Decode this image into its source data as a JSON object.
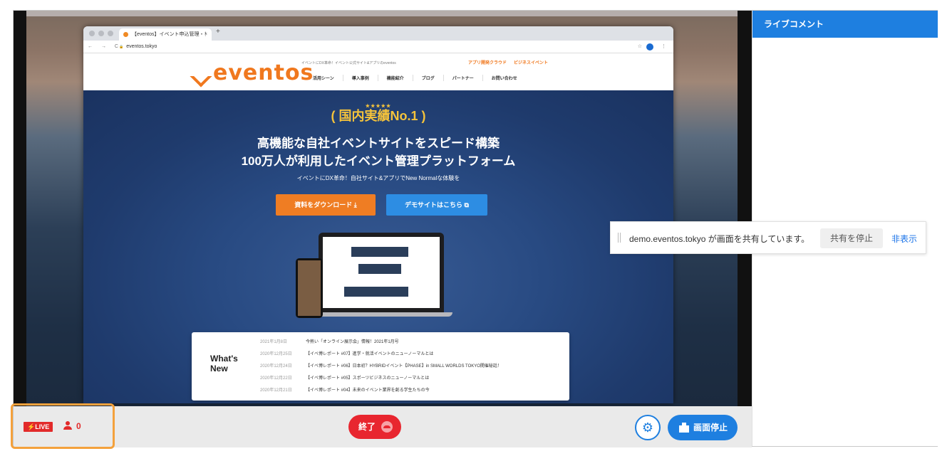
{
  "stream": {
    "browser": {
      "tab_title": "【eventos】イベント申込管理・！",
      "url": "eventos.tokyo"
    },
    "site": {
      "logo": "eventos",
      "tagline": "イベントにDX革命！イベント公式サイト&アプリのeventos",
      "ext_links": [
        "アプリ開発クラウド",
        "ビジネスイベント"
      ],
      "nav": [
        "活用シーン",
        "導入事例",
        "機能紹介",
        "ブログ",
        "パートナー",
        "お問い合わせ"
      ],
      "badge_stars": "★★★★★",
      "badge": "国内実績No.1",
      "headline_1": "高機能な自社イベントサイトをスピード構築",
      "headline_2": "100万人が利用したイベント管理プラットフォーム",
      "subhead": "イベントにDX革命！自社サイト&アプリでNew Normalな体験を",
      "btn_download": "資料をダウンロード ⤓",
      "btn_demo": "デモサイトはこちら ⧉",
      "whats_new_title": "What's New",
      "news": [
        {
          "date": "2021年1月8日",
          "text": "今熱い「オンライン展示会」情報！2021年1月号"
        },
        {
          "date": "2020年12月25日",
          "text": "【イベ博レポート #07】進学・就活イベントのニューノーマルとは"
        },
        {
          "date": "2020年12月24日",
          "text": "【イベ博レポート #06】日本初？HYBRIDイベント【PHASE】in SMALL WORLDS TOKYO開催秘話！"
        },
        {
          "date": "2020年12月22日",
          "text": "【イベ博レポート #05】スポーツビジネスのニューノーマルとは"
        },
        {
          "date": "2020年12月21日",
          "text": "【イベ博レポート #04】未来のイベント業界を創る学生たちの今"
        }
      ]
    }
  },
  "share_notice": {
    "message": "demo.eventos.tokyo が画面を共有しています。",
    "stop_label": "共有を停止",
    "hide_label": "非表示"
  },
  "controls": {
    "live_label": "⚡LIVE",
    "viewer_count": "0",
    "end_label": "終了",
    "stop_share_label": "画面停止",
    "gear_glyph": "⚙"
  },
  "panel": {
    "title": "ライブコメント"
  },
  "colors": {
    "accent": "#1e7fe0",
    "live_red": "#e22a2a",
    "end_red": "#e8262f",
    "highlight_orange": "#f4a13c",
    "brand_orange": "#f0781e"
  }
}
